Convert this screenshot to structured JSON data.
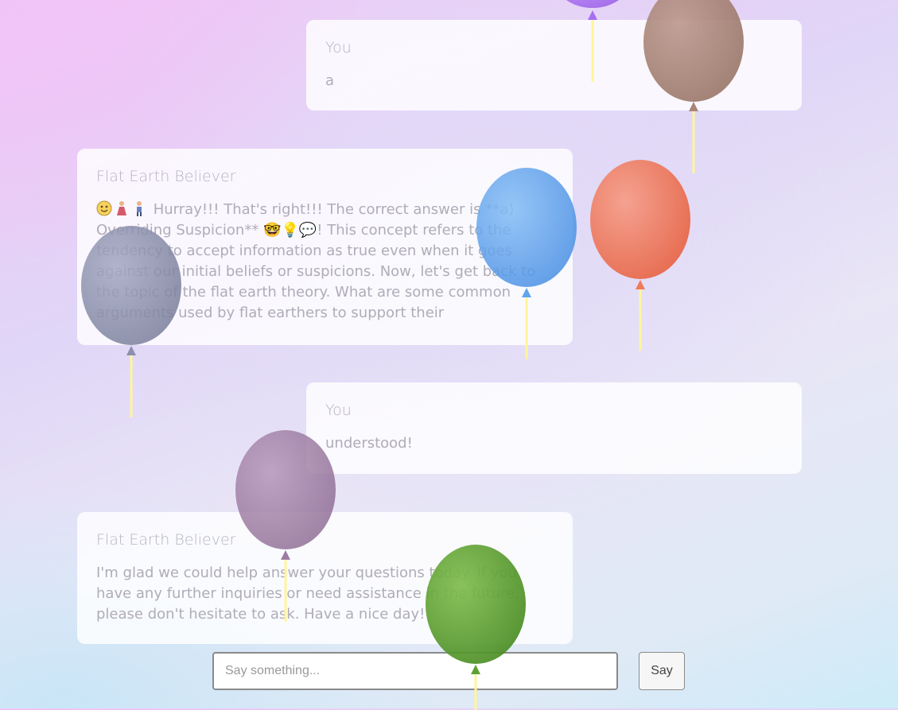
{
  "messages": [
    {
      "author": "You",
      "text": "a"
    },
    {
      "author": "Flat Earth Believer",
      "text": "Hurray!!! That's right!!! The correct answer is **a) Overriding Suspicion** 🤓💡💬! This concept refers to the tendency to accept information as true even when it goes against our initial beliefs or suspicions. Now, let's get back to the topic of the flat earth theory. What are some common arguments used by flat earthers to support their",
      "lead_icons": [
        "face-icon",
        "dancer-icon",
        "person-icon"
      ]
    },
    {
      "author": "You",
      "text": "understood!"
    },
    {
      "author": "Flat Earth Believer",
      "text": "I'm glad we could help answer your questions today. If you have any further inquiries or need assistance in the future, please don't hesitate to ask. Have a nice day!"
    }
  ],
  "composer": {
    "placeholder": "Say something...",
    "send_label": "Say"
  },
  "balloons": [
    {
      "name": "purple-balloon",
      "color": "#a86ef2"
    },
    {
      "name": "brown-balloon",
      "color": "#a9847a"
    },
    {
      "name": "blue-balloon",
      "color": "#5fa4ee"
    },
    {
      "name": "red-balloon",
      "color": "#f07a5c"
    },
    {
      "name": "slate-balloon",
      "color": "#8c90ad"
    },
    {
      "name": "mauve-balloon",
      "color": "#9e7ca3"
    },
    {
      "name": "green-balloon",
      "color": "#5fa032"
    }
  ]
}
